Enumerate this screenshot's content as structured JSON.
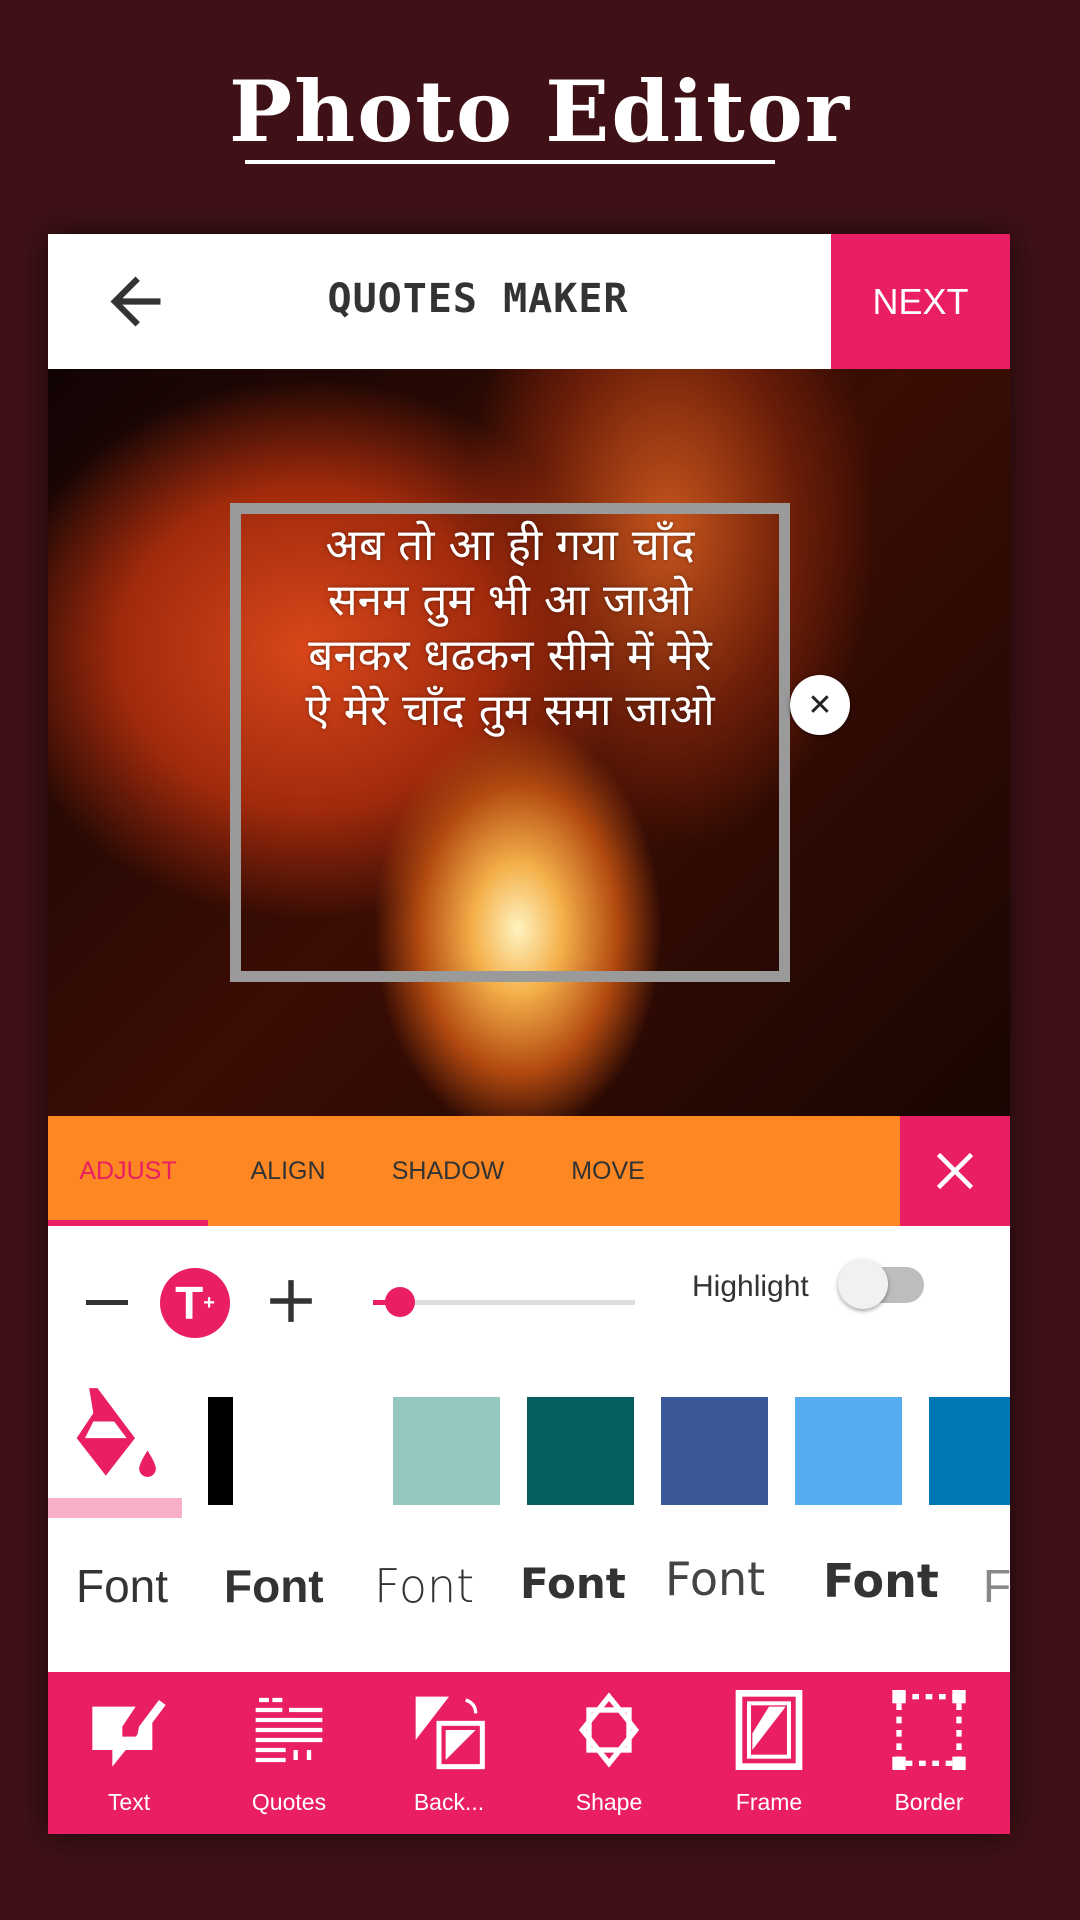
{
  "promo_title": "Photo Editor",
  "header": {
    "title": "QUOTES MAKER",
    "next_label": "NEXT",
    "back_icon": "arrow-left-icon"
  },
  "canvas": {
    "quote_lines": [
      "अब तो आ ही गया चाँद",
      "सनम तुम भी आ जाओ",
      "बनकर धढकन सीने में मेरे",
      "ऐ मेरे चाँद तुम समा जाओ"
    ],
    "close_glyph": "✕"
  },
  "tabs": [
    {
      "label": "ADJUST",
      "active": true
    },
    {
      "label": "ALIGN"
    },
    {
      "label": "SHADOW"
    },
    {
      "label": "MOVE"
    }
  ],
  "colors": {
    "accent": "#e91e63",
    "tabbar": "#fd8722",
    "background": "#3f1116"
  },
  "adjust": {
    "size_icon_label": "T",
    "slider_value_percent": 8,
    "highlight_label": "Highlight",
    "highlight_on": false
  },
  "swatches": [
    "#000000",
    "#ffffff",
    "#95c7c1",
    "#055f5f",
    "#3b5998",
    "#55acee",
    "#0077b5"
  ],
  "fonts": [
    "Font",
    "Font",
    "Font",
    "Font",
    "Font",
    "Font",
    "F"
  ],
  "nav": [
    {
      "label": "Text",
      "icon": "text-edit-icon"
    },
    {
      "label": "Quotes",
      "icon": "quotes-icon"
    },
    {
      "label": "Back...",
      "icon": "background-icon"
    },
    {
      "label": "Shape",
      "icon": "shape-icon"
    },
    {
      "label": "Frame",
      "icon": "frame-icon"
    },
    {
      "label": "Border",
      "icon": "border-icon"
    }
  ]
}
